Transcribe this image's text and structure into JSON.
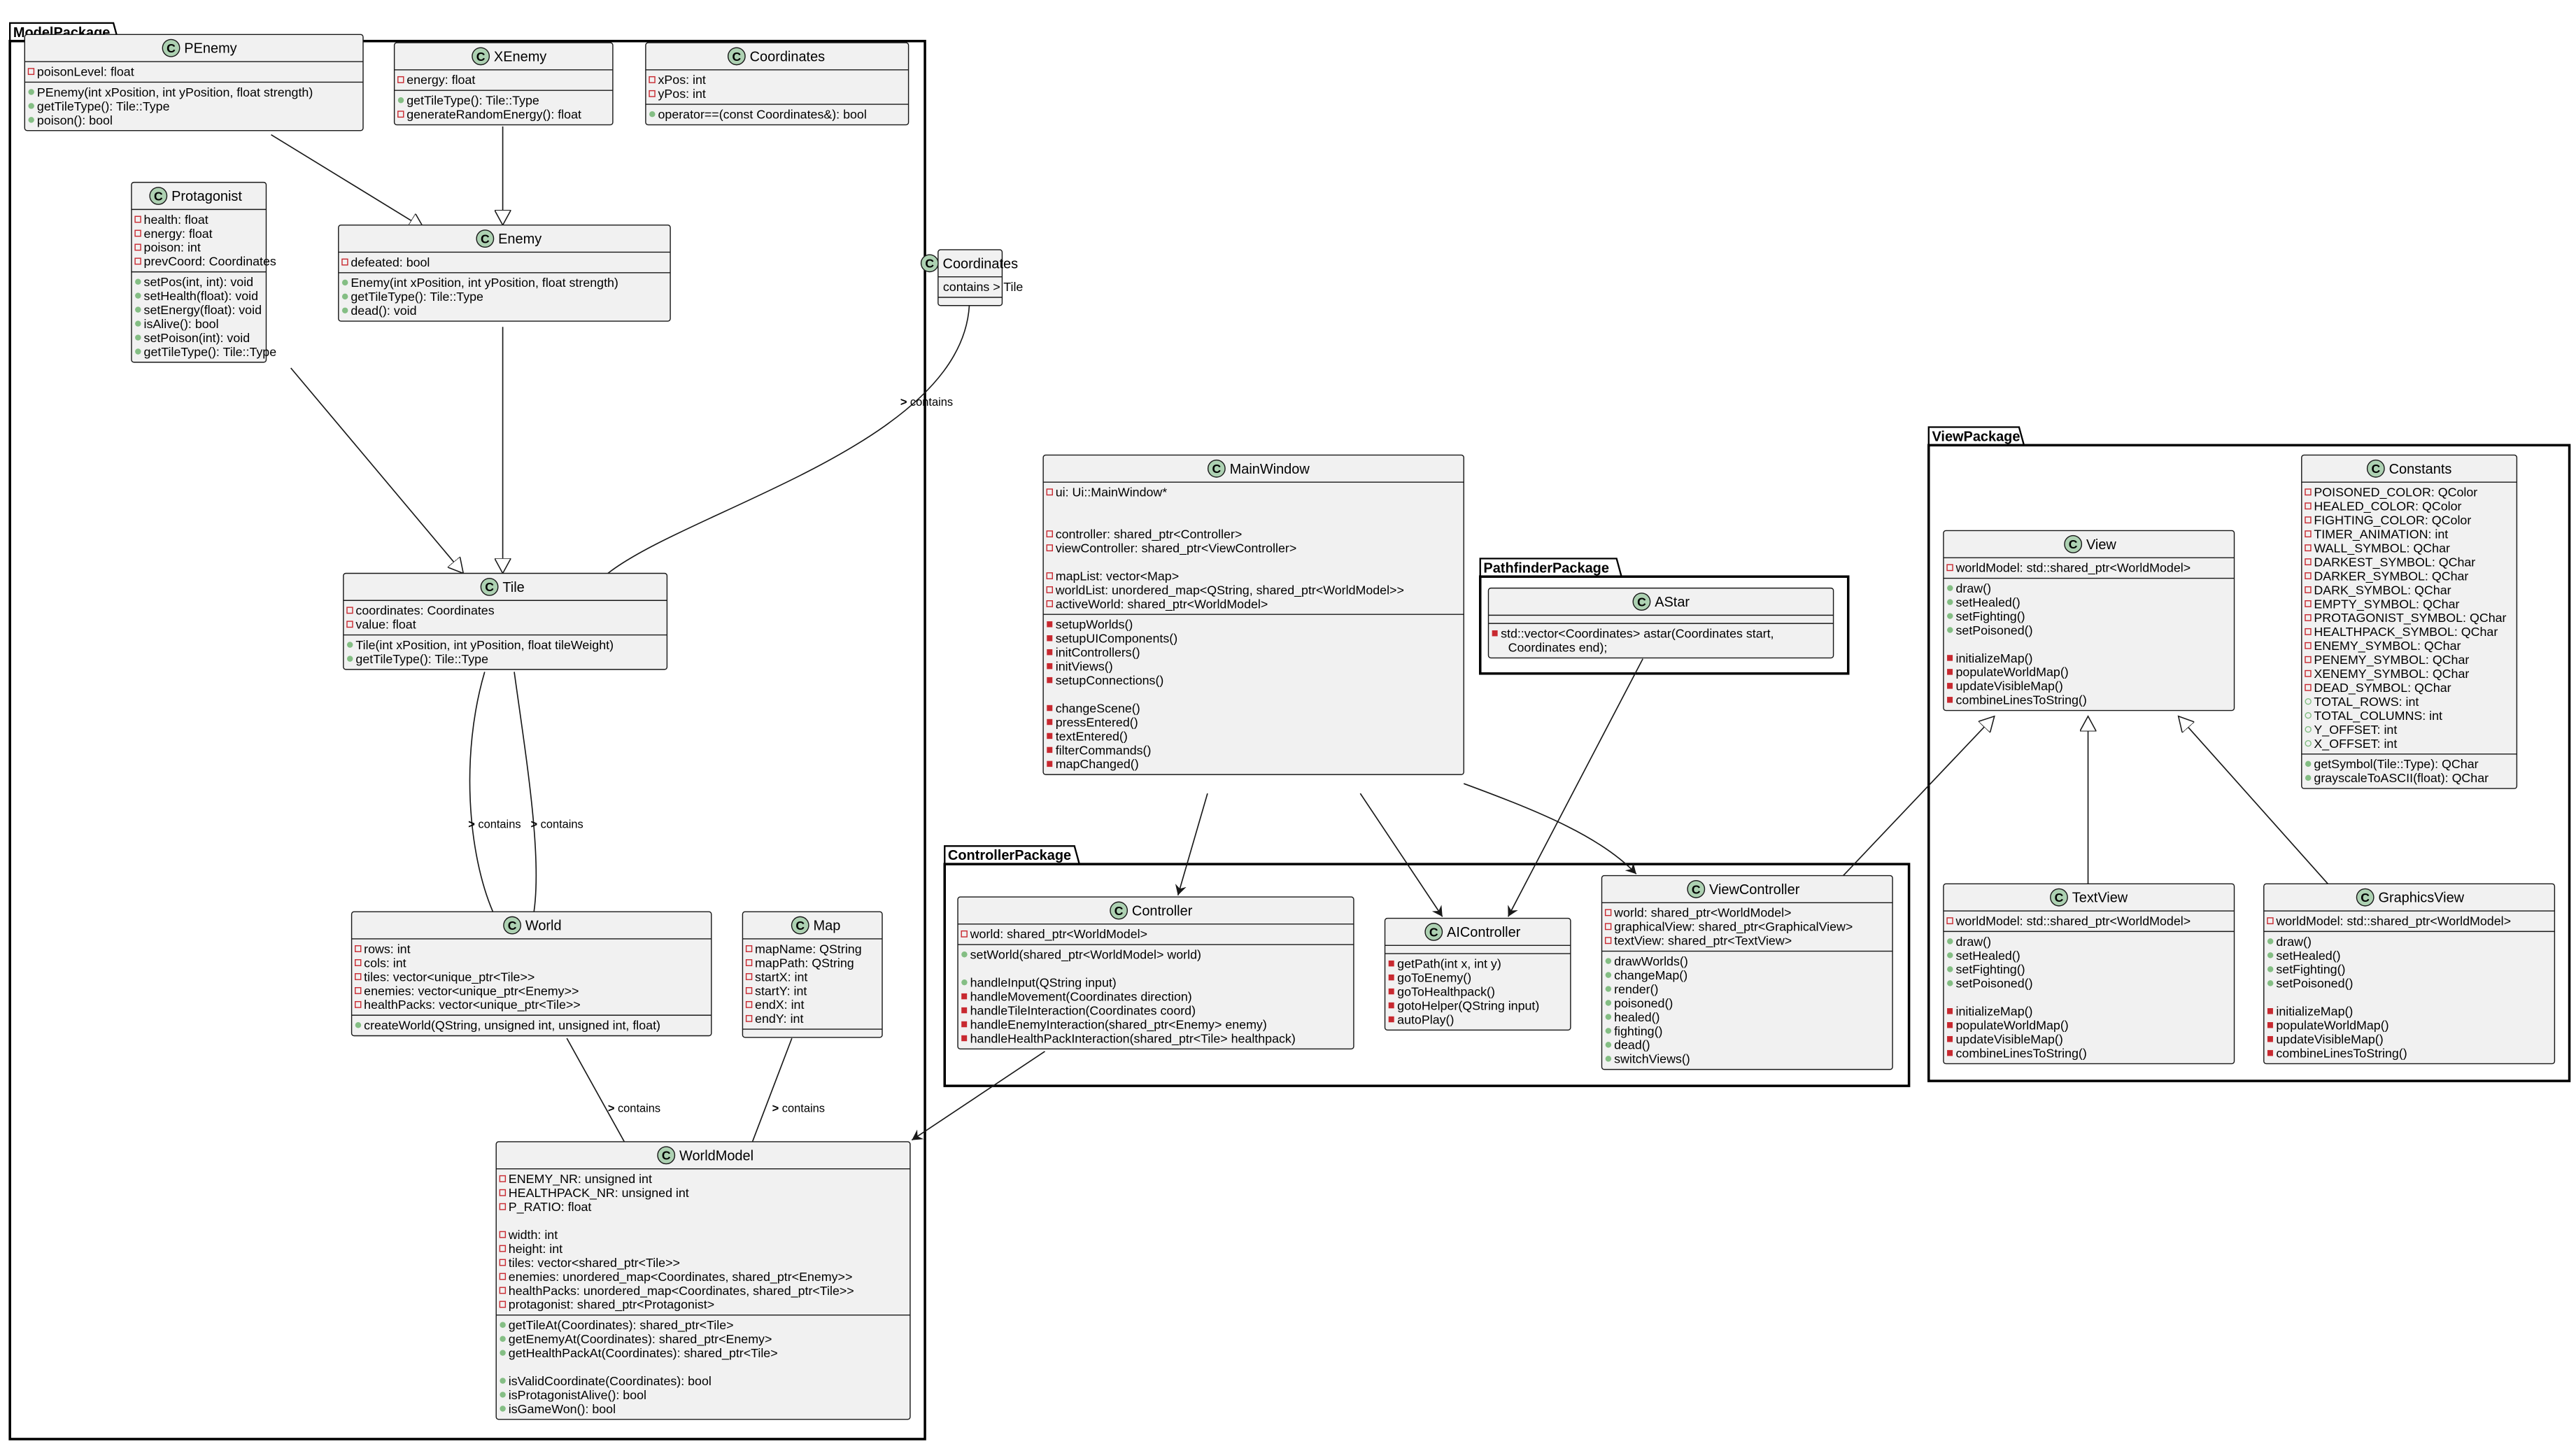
{
  "colors": {
    "class_fill": "#f1f1f1",
    "class_border": "#181818",
    "class_circle": "#add1b2",
    "private_marker": "#c82930",
    "public_marker": "#84be84",
    "line": "#181818"
  },
  "packages": [
    {
      "id": "model",
      "label": "ModelPackage"
    },
    {
      "id": "pathfinder",
      "label": "PathfinderPackage"
    },
    {
      "id": "controller",
      "label": "ControllerPackage"
    },
    {
      "id": "view",
      "label": "ViewPackage"
    }
  ],
  "classes": [
    {
      "id": "PEnemy",
      "name": "PEnemy",
      "stereotype_icon": "C",
      "fields": [
        {
          "v": "private",
          "t": "poisonLevel: float"
        }
      ],
      "methods": [
        {
          "v": "public",
          "t": "PEnemy(int xPosition, int yPosition, float strength)"
        },
        {
          "v": "public",
          "t": "getTileType(): Tile::Type"
        },
        {
          "v": "public",
          "t": "poison(): bool"
        }
      ]
    },
    {
      "id": "XEnemy",
      "name": "XEnemy",
      "stereotype_icon": "C",
      "fields": [
        {
          "v": "private",
          "t": "energy: float"
        }
      ],
      "methods": [
        {
          "v": "public",
          "t": "getTileType(): Tile::Type"
        },
        {
          "v": "private",
          "t": "generateRandomEnergy(): float"
        }
      ]
    },
    {
      "id": "CoordinatesModel",
      "name": "Coordinates",
      "stereotype_icon": "C",
      "fields": [
        {
          "v": "private",
          "t": "xPos: int"
        },
        {
          "v": "private",
          "t": "yPos: int"
        }
      ],
      "methods": [
        {
          "v": "public",
          "t": "operator==(const Coordinates&): bool"
        }
      ]
    },
    {
      "id": "Protagonist",
      "name": "Protagonist",
      "stereotype_icon": "C",
      "fields": [
        {
          "v": "private",
          "t": "health: float"
        },
        {
          "v": "private",
          "t": "energy: float"
        },
        {
          "v": "private",
          "t": "poison: int"
        },
        {
          "v": "private",
          "t": "prevCoord: Coordinates"
        }
      ],
      "methods": [
        {
          "v": "public",
          "t": "setPos(int, int): void"
        },
        {
          "v": "public",
          "t": "setHealth(float): void"
        },
        {
          "v": "public",
          "t": "setEnergy(float): void"
        },
        {
          "v": "public",
          "t": "isAlive(): bool"
        },
        {
          "v": "public",
          "t": "setPoison(int): void"
        },
        {
          "v": "public",
          "t": "getTileType(): Tile::Type"
        }
      ]
    },
    {
      "id": "Enemy",
      "name": "Enemy",
      "stereotype_icon": "C",
      "fields": [
        {
          "v": "private",
          "t": "defeated: bool"
        }
      ],
      "methods": [
        {
          "v": "public",
          "t": "Enemy(int xPosition, int yPosition, float strength)"
        },
        {
          "v": "public",
          "t": "getTileType(): Tile::Type"
        },
        {
          "v": "public",
          "t": "dead(): void"
        }
      ]
    },
    {
      "id": "CoordinatesOuter",
      "name": "Coordinates",
      "stereotype_icon": "C",
      "fields": [
        {
          "v": "none",
          "t": "contains > Tile"
        }
      ],
      "methods": []
    },
    {
      "id": "Tile",
      "name": "Tile",
      "stereotype_icon": "C",
      "fields": [
        {
          "v": "private",
          "t": "coordinates: Coordinates"
        },
        {
          "v": "private",
          "t": "value: float"
        }
      ],
      "methods": [
        {
          "v": "public",
          "t": "Tile(int xPosition, int yPosition, float tileWeight)"
        },
        {
          "v": "public",
          "t": "getTileType(): Tile::Type"
        }
      ]
    },
    {
      "id": "World",
      "name": "World",
      "stereotype_icon": "C",
      "fields": [
        {
          "v": "private",
          "t": "rows: int"
        },
        {
          "v": "private",
          "t": "cols: int"
        },
        {
          "v": "private",
          "t": "tiles: vector<unique_ptr<Tile>>"
        },
        {
          "v": "private",
          "t": "enemies: vector<unique_ptr<Enemy>>"
        },
        {
          "v": "private",
          "t": "healthPacks: vector<unique_ptr<Tile>>"
        }
      ],
      "methods": [
        {
          "v": "public",
          "t": "createWorld(QString, unsigned int, unsigned int, float)"
        }
      ]
    },
    {
      "id": "Map",
      "name": "Map",
      "stereotype_icon": "C",
      "fields": [
        {
          "v": "private",
          "t": "mapName: QString"
        },
        {
          "v": "private",
          "t": "mapPath: QString"
        },
        {
          "v": "private",
          "t": "startX: int"
        },
        {
          "v": "private",
          "t": "startY: int"
        },
        {
          "v": "private",
          "t": "endX: int"
        },
        {
          "v": "private",
          "t": "endY: int"
        }
      ],
      "methods": []
    },
    {
      "id": "WorldModel",
      "name": "WorldModel",
      "stereotype_icon": "C",
      "fields": [
        {
          "v": "private",
          "t": "ENEMY_NR: unsigned int"
        },
        {
          "v": "private",
          "t": "HEALTHPACK_NR: unsigned int"
        },
        {
          "v": "private",
          "t": "P_RATIO: float"
        },
        {
          "v": "blank",
          "t": ""
        },
        {
          "v": "private",
          "t": "width: int"
        },
        {
          "v": "private",
          "t": "height: int"
        },
        {
          "v": "private",
          "t": "tiles: vector<shared_ptr<Tile>>"
        },
        {
          "v": "private",
          "t": "enemies: unordered_map<Coordinates, shared_ptr<Enemy>>"
        },
        {
          "v": "private",
          "t": "healthPacks: unordered_map<Coordinates, shared_ptr<Tile>>"
        },
        {
          "v": "private",
          "t": "protagonist: shared_ptr<Protagonist>"
        }
      ],
      "methods": [
        {
          "v": "public",
          "t": "getTileAt(Coordinates): shared_ptr<Tile>"
        },
        {
          "v": "public",
          "t": "getEnemyAt(Coordinates): shared_ptr<Enemy>"
        },
        {
          "v": "public",
          "t": "getHealthPackAt(Coordinates): shared_ptr<Tile>"
        },
        {
          "v": "blank",
          "t": ""
        },
        {
          "v": "public",
          "t": "isValidCoordinate(Coordinates): bool"
        },
        {
          "v": "public",
          "t": "isProtagonistAlive(): bool"
        },
        {
          "v": "public",
          "t": "isGameWon(): bool"
        }
      ]
    },
    {
      "id": "MainWindow",
      "name": "MainWindow",
      "stereotype_icon": "C",
      "fields": [
        {
          "v": "private",
          "t": "ui: Ui::MainWindow*"
        },
        {
          "v": "blank",
          "t": ""
        },
        {
          "v": "blank",
          "t": ""
        },
        {
          "v": "private",
          "t": "controller: shared_ptr<Controller>"
        },
        {
          "v": "private",
          "t": "viewController: shared_ptr<ViewController>"
        },
        {
          "v": "blank",
          "t": ""
        },
        {
          "v": "private",
          "t": "mapList: vector<Map>"
        },
        {
          "v": "private",
          "t": "worldList: unordered_map<QString, shared_ptr<WorldModel>>"
        },
        {
          "v": "private",
          "t": "activeWorld: shared_ptr<WorldModel>"
        }
      ],
      "methods": [
        {
          "v": "privatem",
          "t": "setupWorlds()"
        },
        {
          "v": "privatem",
          "t": "setupUIComponents()"
        },
        {
          "v": "privatem",
          "t": "initControllers()"
        },
        {
          "v": "privatem",
          "t": "initViews()"
        },
        {
          "v": "privatem",
          "t": "setupConnections()"
        },
        {
          "v": "blank",
          "t": ""
        },
        {
          "v": "privatem",
          "t": "changeScene()"
        },
        {
          "v": "privatem",
          "t": "pressEntered()"
        },
        {
          "v": "privatem",
          "t": "textEntered()"
        },
        {
          "v": "privatem",
          "t": "filterCommands()"
        },
        {
          "v": "privatem",
          "t": "mapChanged()"
        }
      ]
    },
    {
      "id": "AStar",
      "name": "AStar",
      "stereotype_icon": "C",
      "fields": [],
      "methods": [
        {
          "v": "privatem",
          "t": "std::vector<Coordinates> astar(Coordinates start,"
        },
        {
          "v": "none",
          "t": "Coordinates end);"
        }
      ]
    },
    {
      "id": "Controller",
      "name": "Controller",
      "stereotype_icon": "C",
      "fields": [
        {
          "v": "private",
          "t": "world: shared_ptr<WorldModel>"
        }
      ],
      "methods": [
        {
          "v": "public",
          "t": "setWorld(shared_ptr<WorldModel> world)"
        },
        {
          "v": "blank",
          "t": ""
        },
        {
          "v": "public",
          "t": "handleInput(QString input)"
        },
        {
          "v": "privatem",
          "t": "handleMovement(Coordinates direction)"
        },
        {
          "v": "privatem",
          "t": "handleTileInteraction(Coordinates coord)"
        },
        {
          "v": "privatem",
          "t": "handleEnemyInteraction(shared_ptr<Enemy> enemy)"
        },
        {
          "v": "privatem",
          "t": "handleHealthPackInteraction(shared_ptr<Tile> healthpack)"
        }
      ]
    },
    {
      "id": "AIController",
      "name": "AIController",
      "stereotype_icon": "C",
      "fields": [],
      "methods": [
        {
          "v": "privatem",
          "t": "getPath(int x, int y)"
        },
        {
          "v": "privatem",
          "t": "goToEnemy()"
        },
        {
          "v": "privatem",
          "t": "goToHealthpack()"
        },
        {
          "v": "privatem",
          "t": "gotoHelper(QString input)"
        },
        {
          "v": "privatem",
          "t": "autoPlay()"
        }
      ]
    },
    {
      "id": "ViewController",
      "name": "ViewController",
      "stereotype_icon": "C",
      "fields": [
        {
          "v": "private",
          "t": "world: shared_ptr<WorldModel>"
        },
        {
          "v": "private",
          "t": "graphicalView: shared_ptr<GraphicalView>"
        },
        {
          "v": "private",
          "t": "textView: shared_ptr<TextView>"
        }
      ],
      "methods": [
        {
          "v": "public",
          "t": "drawWorlds()"
        },
        {
          "v": "public",
          "t": "changeMap()"
        },
        {
          "v": "public",
          "t": "render()"
        },
        {
          "v": "public",
          "t": "poisoned()"
        },
        {
          "v": "public",
          "t": "healed()"
        },
        {
          "v": "public",
          "t": "fighting()"
        },
        {
          "v": "public",
          "t": "dead()"
        },
        {
          "v": "public",
          "t": "switchViews()"
        }
      ]
    },
    {
      "id": "View",
      "name": "View",
      "stereotype_icon": "C",
      "fields": [
        {
          "v": "private",
          "t": "worldModel: std::shared_ptr<WorldModel>"
        }
      ],
      "methods": [
        {
          "v": "public",
          "t": "draw()"
        },
        {
          "v": "public",
          "t": "setHealed()"
        },
        {
          "v": "public",
          "t": "setFighting()"
        },
        {
          "v": "public",
          "t": "setPoisoned()"
        },
        {
          "v": "blank",
          "t": ""
        },
        {
          "v": "privatem",
          "t": "initializeMap()"
        },
        {
          "v": "privatem",
          "t": "populateWorldMap()"
        },
        {
          "v": "privatem",
          "t": "updateVisibleMap()"
        },
        {
          "v": "privatem",
          "t": "combineLinesToString()"
        }
      ]
    },
    {
      "id": "Constants",
      "name": "Constants",
      "stereotype_icon": "C",
      "fields": [
        {
          "v": "private",
          "t": "POISONED_COLOR: QColor"
        },
        {
          "v": "private",
          "t": "HEALED_COLOR: QColor"
        },
        {
          "v": "private",
          "t": "FIGHTING_COLOR: QColor"
        },
        {
          "v": "private",
          "t": "TIMER_ANIMATION: int"
        },
        {
          "v": "private",
          "t": "WALL_SYMBOL: QChar"
        },
        {
          "v": "private",
          "t": "DARKEST_SYMBOL: QChar"
        },
        {
          "v": "private",
          "t": "DARKER_SYMBOL: QChar"
        },
        {
          "v": "private",
          "t": "DARK_SYMBOL: QChar"
        },
        {
          "v": "private",
          "t": "EMPTY_SYMBOL: QChar"
        },
        {
          "v": "private",
          "t": "PROTAGONIST_SYMBOL: QChar"
        },
        {
          "v": "private",
          "t": "HEALTHPACK_SYMBOL: QChar"
        },
        {
          "v": "private",
          "t": "ENEMY_SYMBOL: QChar"
        },
        {
          "v": "private",
          "t": "PENEMY_SYMBOL: QChar"
        },
        {
          "v": "private",
          "t": "XENEMY_SYMBOL: QChar"
        },
        {
          "v": "private",
          "t": "DEAD_SYMBOL: QChar"
        },
        {
          "v": "publicf",
          "t": "TOTAL_ROWS: int"
        },
        {
          "v": "publicf",
          "t": "TOTAL_COLUMNS: int"
        },
        {
          "v": "publicf",
          "t": "Y_OFFSET: int"
        },
        {
          "v": "publicf",
          "t": "X_OFFSET: int"
        }
      ],
      "methods": [
        {
          "v": "public",
          "t": "getSymbol(Tile::Type): QChar"
        },
        {
          "v": "public",
          "t": "grayscaleToASCII(float): QChar"
        }
      ]
    },
    {
      "id": "TextView",
      "name": "TextView",
      "stereotype_icon": "C",
      "fields": [
        {
          "v": "private",
          "t": "worldModel: std::shared_ptr<WorldModel>"
        }
      ],
      "methods": [
        {
          "v": "public",
          "t": "draw()"
        },
        {
          "v": "public",
          "t": "setHealed()"
        },
        {
          "v": "public",
          "t": "setFighting()"
        },
        {
          "v": "public",
          "t": "setPoisoned()"
        },
        {
          "v": "blank",
          "t": ""
        },
        {
          "v": "privatem",
          "t": "initializeMap()"
        },
        {
          "v": "privatem",
          "t": "populateWorldMap()"
        },
        {
          "v": "privatem",
          "t": "updateVisibleMap()"
        },
        {
          "v": "privatem",
          "t": "combineLinesToString()"
        }
      ]
    },
    {
      "id": "GraphicsView",
      "name": "GraphicsView",
      "stereotype_icon": "C",
      "fields": [
        {
          "v": "private",
          "t": "worldModel: std::shared_ptr<WorldModel>"
        }
      ],
      "methods": [
        {
          "v": "public",
          "t": "draw()"
        },
        {
          "v": "public",
          "t": "setHealed()"
        },
        {
          "v": "public",
          "t": "setFighting()"
        },
        {
          "v": "public",
          "t": "setPoisoned()"
        },
        {
          "v": "blank",
          "t": ""
        },
        {
          "v": "privatem",
          "t": "initializeMap()"
        },
        {
          "v": "privatem",
          "t": "populateWorldMap()"
        },
        {
          "v": "privatem",
          "t": "updateVisibleMap()"
        },
        {
          "v": "privatem",
          "t": "combineLinesToString()"
        }
      ]
    }
  ],
  "relations": [
    {
      "id": "penemy-enemy",
      "from": "PEnemy",
      "to": "Enemy",
      "type": "inheritance"
    },
    {
      "id": "xenemy-enemy",
      "from": "XEnemy",
      "to": "Enemy",
      "type": "inheritance"
    },
    {
      "id": "protagonist-tile",
      "from": "Protagonist",
      "to": "Tile",
      "type": "inheritance"
    },
    {
      "id": "enemy-tile",
      "from": "Enemy",
      "to": "Tile",
      "type": "inheritance"
    },
    {
      "id": "coordinates-tile",
      "from": "CoordinatesOuter",
      "to": "Tile",
      "type": "association",
      "label": "contains",
      "direction_glyph": ">"
    },
    {
      "id": "tile-world-1",
      "from": "Tile",
      "to": "World",
      "type": "association",
      "label": "contains",
      "direction_glyph": ">"
    },
    {
      "id": "tile-world-2",
      "from": "Tile",
      "to": "World",
      "type": "association",
      "label": "contains",
      "direction_glyph": ">"
    },
    {
      "id": "world-worldmodel",
      "from": "World",
      "to": "WorldModel",
      "type": "association",
      "label": "contains",
      "direction_glyph": ">"
    },
    {
      "id": "map-worldmodel",
      "from": "Map",
      "to": "WorldModel",
      "type": "association",
      "label": "contains",
      "direction_glyph": ">"
    },
    {
      "id": "controller-worldmodel",
      "from": "Controller",
      "to": "WorldModel",
      "type": "dependency"
    },
    {
      "id": "mainwindow-controller",
      "from": "MainWindow",
      "to": "Controller",
      "type": "dependency"
    },
    {
      "id": "mainwindow-aicontroller",
      "from": "MainWindow",
      "to": "AIController",
      "type": "dependency"
    },
    {
      "id": "mainwindow-viewcontroller",
      "from": "MainWindow",
      "to": "ViewController",
      "type": "dependency"
    },
    {
      "id": "astar-aicontroller",
      "from": "AStar",
      "to": "AIController",
      "type": "dependency"
    },
    {
      "id": "viewcontroller-view",
      "from": "ViewController",
      "to": "View",
      "type": "inheritance"
    },
    {
      "id": "textview-view",
      "from": "TextView",
      "to": "View",
      "type": "inheritance"
    },
    {
      "id": "graphicsview-view",
      "from": "GraphicsView",
      "to": "View",
      "type": "inheritance"
    }
  ]
}
